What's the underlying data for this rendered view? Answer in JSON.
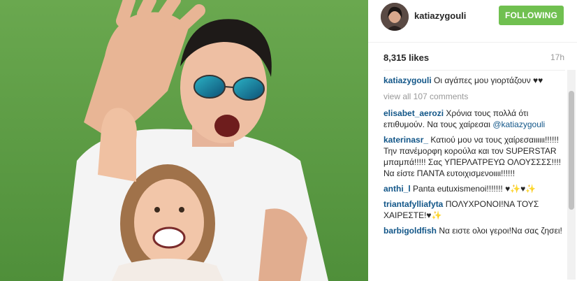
{
  "header": {
    "username": "katiazygouli",
    "follow_label": "FOLLOWING"
  },
  "stats": {
    "likes": "8,315 likes",
    "time": "17h"
  },
  "caption": {
    "user": "katiazygouli",
    "text": "Οι αγάπες μου γιορτάζουν ♥♥"
  },
  "view_all": "view all 107 comments",
  "comments": [
    {
      "user": "elisabet_aerozi",
      "text": "Χρόνια τους πολλά ότι επιθυμούν. Να τους χαίρεσαι",
      "mention": "@katiazygouli"
    },
    {
      "user": "katerinasr_",
      "text": "Κατιού μου να τους χαίρεσαιιιιιι!!!!!! Την πανέμορφη κορούλα και τον SUPERSTAR μπαμπά!!!!! Σας ΥΠΕΡΛΑΤΡΕΥΩ ΟΛΟΥΣΣΣΣ!!!! Να είστε ΠΑΝΤΑ ευτοιχισμενοιιιι!!!!!!",
      "mention": ""
    },
    {
      "user": "anthi_l",
      "text": "Panta eutuxismenoi!!!!!!! ♥✨♥✨",
      "mention": ""
    },
    {
      "user": "triantafylliafyta",
      "text": "ΠΟΛΥΧΡΟΝΟΙ!ΝΑ ΤΟΥΣ ΧΑΙΡΕΣΤΕ!♥✨",
      "mention": ""
    },
    {
      "user": "barbigoldfish",
      "text": "Να ειστε ολοι γεροι!Να σας ζησει!",
      "mention": ""
    }
  ],
  "colors": {
    "follow_green": "#70c050",
    "link_blue": "#125688",
    "muted": "#999999"
  }
}
